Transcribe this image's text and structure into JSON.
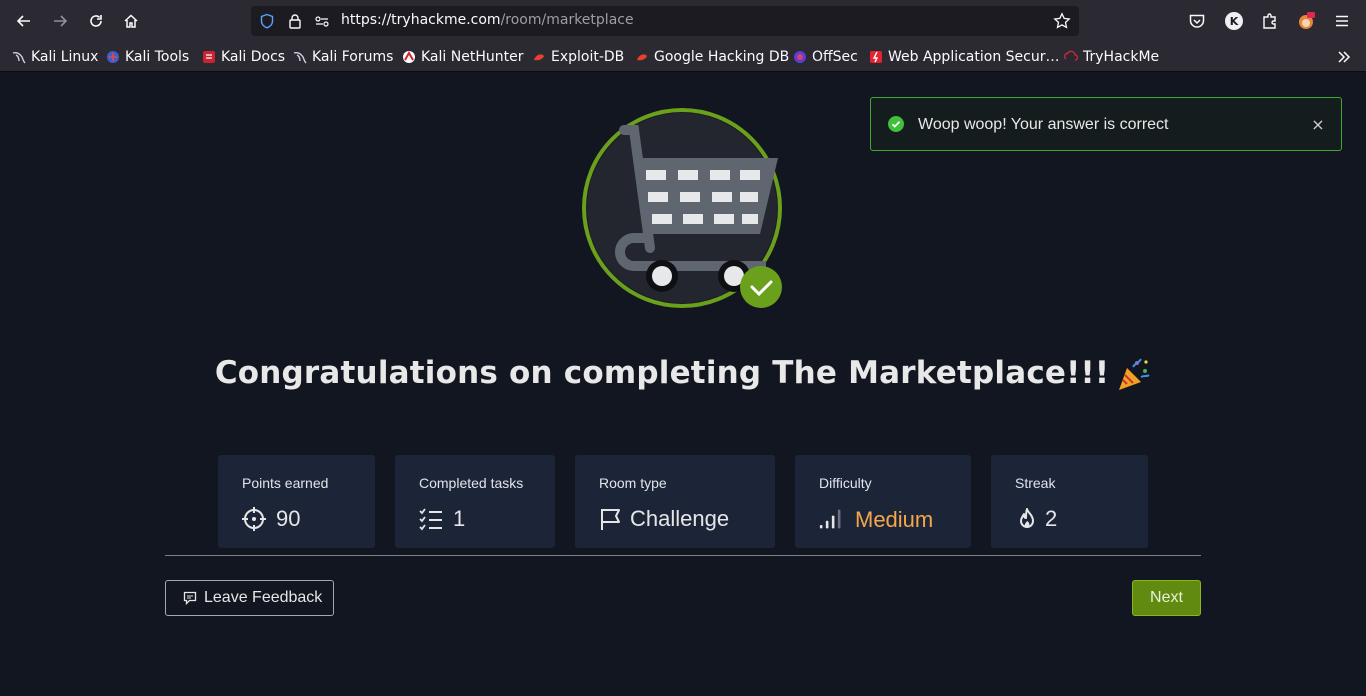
{
  "browser": {
    "url_host": "https://tryhackme.com",
    "url_path": "/room/marketplace",
    "profile_initial": "K",
    "bookmarks": [
      {
        "label": "Kali Linux",
        "icon": "kali-dragon-icon"
      },
      {
        "label": "Kali Tools",
        "icon": "kali-tools-icon"
      },
      {
        "label": "Kali Docs",
        "icon": "kali-docs-icon"
      },
      {
        "label": "Kali Forums",
        "icon": "kali-dragon-icon"
      },
      {
        "label": "Kali NetHunter",
        "icon": "nethunter-icon"
      },
      {
        "label": "Exploit-DB",
        "icon": "exploit-db-icon"
      },
      {
        "label": "Google Hacking DB",
        "icon": "ghdb-icon"
      },
      {
        "label": "OffSec",
        "icon": "offsec-icon"
      },
      {
        "label": "Web Application Secur…",
        "icon": "webapp-icon"
      },
      {
        "label": "TryHackMe",
        "icon": "tryhackme-icon"
      }
    ]
  },
  "toast": {
    "message": "Woop woop! Your answer is correct",
    "close": "×",
    "color": "#3fa732"
  },
  "main": {
    "title": "Congratulations on completing The Marketplace!!!",
    "stats": [
      {
        "label": "Points earned",
        "value": "90",
        "icon": "crosshair-icon"
      },
      {
        "label": "Completed tasks",
        "value": "1",
        "icon": "task-list-icon"
      },
      {
        "label": "Room type",
        "value": "Challenge",
        "icon": "flag-icon"
      },
      {
        "label": "Difficulty",
        "value": "Medium",
        "icon": "signal-bars-icon",
        "color": "#f5a64b"
      },
      {
        "label": "Streak",
        "value": "2",
        "icon": "flame-icon"
      }
    ],
    "feedback_label": "Leave Feedback",
    "next_label": "Next",
    "accent": "#618a10"
  }
}
